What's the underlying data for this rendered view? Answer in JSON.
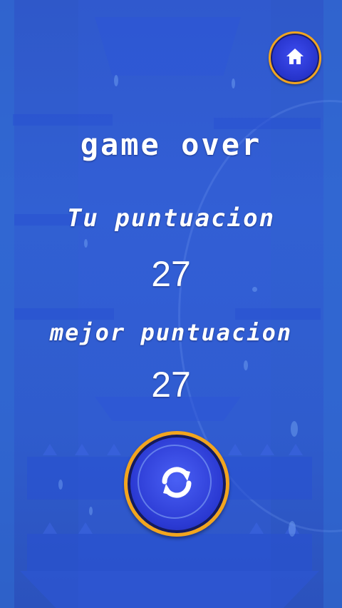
{
  "screen": {
    "title": "game over",
    "current_score_label": "Tu puntuacion",
    "current_score": "27",
    "best_score_label": "mejor puntuacion",
    "best_score": "27"
  },
  "buttons": {
    "home_icon": "home-icon",
    "restart_icon": "refresh-icon"
  },
  "colors": {
    "background": "#3160d3",
    "button_fill": "#2a39d2",
    "button_ring": "#f2a51e",
    "text": "#ffffff"
  }
}
